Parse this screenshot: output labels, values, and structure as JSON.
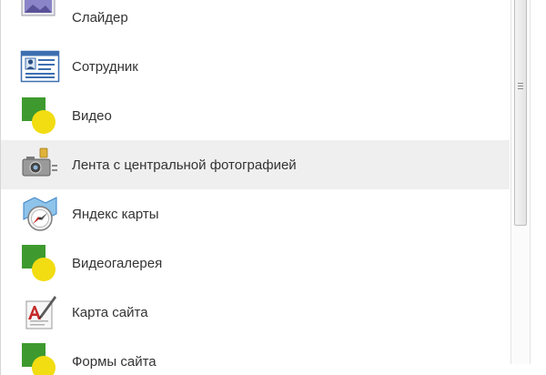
{
  "list": {
    "items": [
      {
        "label": "Слайдер",
        "icon": "slider-image-icon"
      },
      {
        "label": "Сотрудник",
        "icon": "employee-card-icon"
      },
      {
        "label": "Видео",
        "icon": "green-yellow-placeholder-icon"
      },
      {
        "label": "Лента с центральной фотографией",
        "icon": "camera-icon",
        "state": "hovered"
      },
      {
        "label": "Яндекс карты",
        "icon": "compass-map-icon"
      },
      {
        "label": "Видеогалерея",
        "icon": "green-yellow-placeholder-icon"
      },
      {
        "label": "Карта сайта",
        "icon": "sitemap-pen-icon"
      },
      {
        "label": "Формы сайта",
        "icon": "green-yellow-placeholder-icon"
      }
    ]
  },
  "colors": {
    "hover_row": "#efefef",
    "label_text": "#333333",
    "placeholder_green": "#3e9a2e",
    "placeholder_yellow": "#f2dc12"
  }
}
